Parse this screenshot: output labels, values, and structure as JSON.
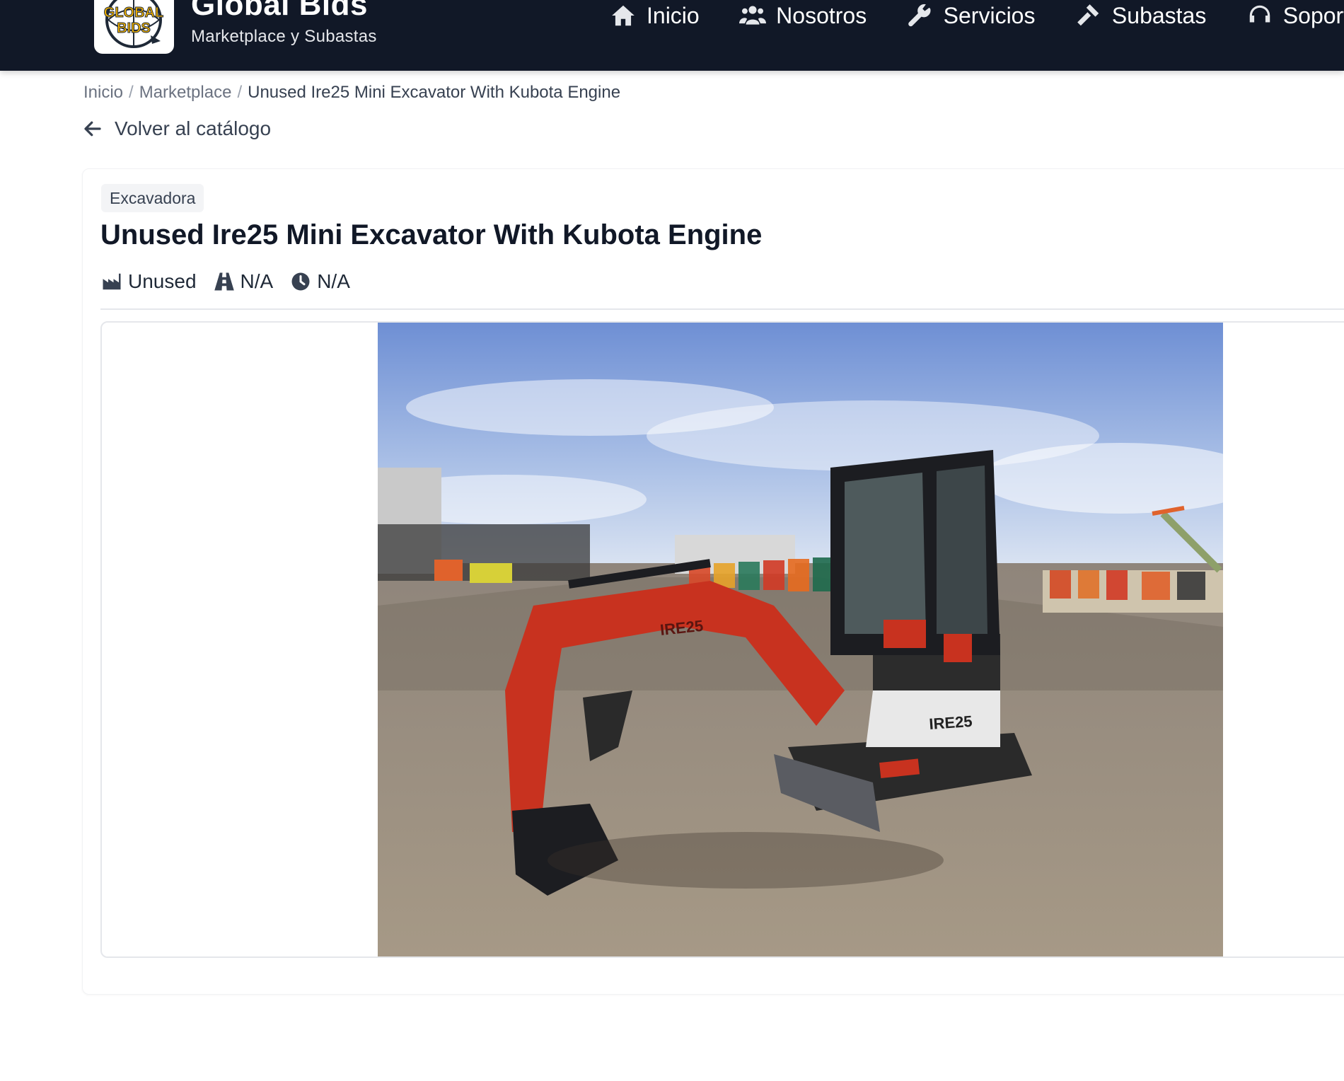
{
  "header": {
    "brand_name": "Global Bids",
    "tagline": "Marketplace y Subastas",
    "logo_text_top": "GLOBAL",
    "logo_text_bottom": "BIDS",
    "nav": [
      {
        "label": "Inicio",
        "icon": "home-icon"
      },
      {
        "label": "Nosotros",
        "icon": "users-icon"
      },
      {
        "label": "Servicios",
        "icon": "wrench-icon"
      },
      {
        "label": "Subastas",
        "icon": "gavel-icon"
      },
      {
        "label": "Soporte",
        "icon": "headset-icon"
      }
    ]
  },
  "breadcrumb": {
    "items": [
      "Inicio",
      "Marketplace"
    ],
    "current": "Unused Ire25 Mini Excavator With Kubota Engine"
  },
  "back_link": {
    "label": "Volver al catálogo",
    "icon": "arrow-left-icon"
  },
  "listing": {
    "category": "Excavadora",
    "title": "Unused Ire25 Mini Excavator With Kubota Engine",
    "specs": [
      {
        "icon": "industry-icon",
        "value": "Unused"
      },
      {
        "icon": "road-icon",
        "value": "N/A"
      },
      {
        "icon": "clock-icon",
        "value": "N/A"
      }
    ],
    "photo_markings": [
      "IRE25",
      "IRE25"
    ]
  },
  "colors": {
    "header_bg": "#111827",
    "logo_gold": "#f5b400",
    "excavator_red": "#c8321f"
  }
}
